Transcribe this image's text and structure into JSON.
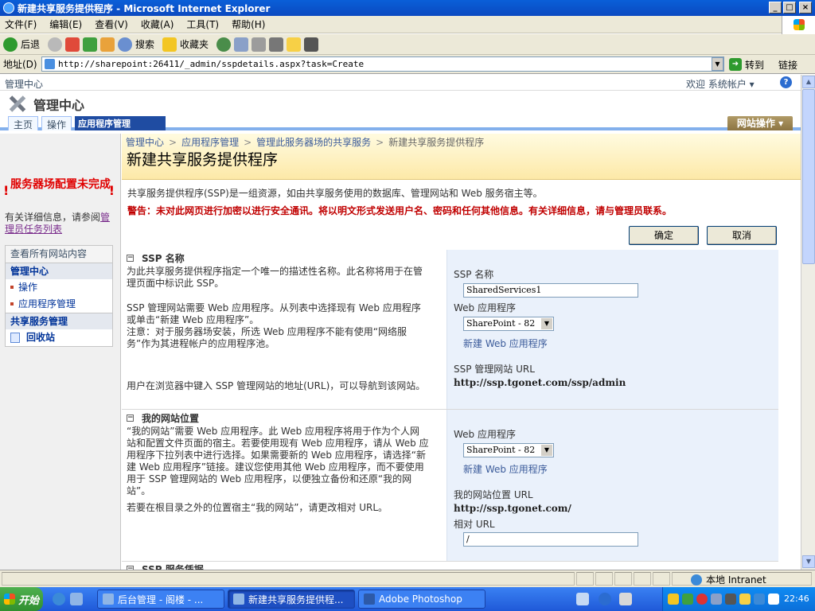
{
  "window": {
    "title": "新建共享服务提供程序 - Microsoft Internet Explorer",
    "min": "_",
    "max": "□",
    "close": "×"
  },
  "menu": [
    "文件(F)",
    "编辑(E)",
    "查看(V)",
    "收藏(A)",
    "工具(T)",
    "帮助(H)"
  ],
  "toolbar": {
    "back": "后退",
    "search": "搜索",
    "favorites": "收藏夹"
  },
  "address": {
    "label": "地址(D)",
    "url": "http://sharepoint:26411/_admin/sspdetails.aspx?task=Create",
    "go": "转到",
    "links": "链接"
  },
  "sp": {
    "top_crumb": "管理中心",
    "welcome": "欢迎 系统帐户 ▾",
    "help": "?",
    "site_title": "管理中心",
    "tabs": [
      "主页",
      "操作",
      "应用程序管理"
    ],
    "site_actions": "网站操作 ▾"
  },
  "leftnav": {
    "warning": "服务器场配置未完成",
    "note_prefix": "有关详细信息，请参阅",
    "note_link": "管理员任务列表",
    "view_all": "查看所有网站内容",
    "head1": "管理中心",
    "items": [
      "操作",
      "应用程序管理"
    ],
    "head2": "共享服务管理",
    "recycle": "回收站"
  },
  "main": {
    "breadcrumb": [
      "管理中心",
      "应用程序管理",
      "管理此服务器场的共享服务",
      "新建共享服务提供程序"
    ],
    "title": "新建共享服务提供程序",
    "desc": "共享服务提供程序(SSP)是一组资源，如由共享服务使用的数据库、管理网站和 Web 服务宿主等。",
    "warning": "警告：未对此网页进行加密以进行安全通讯。将以明文形式发送用户名、密码和任何其他信息。有关详细信息，请与管理员联系。",
    "ok": "确定",
    "cancel": "取消"
  },
  "ssp": {
    "title": "SSP 名称",
    "desc1": "为此共享服务提供程序指定一个唯一的描述性名称。此名称将用于在管理页面中标识此 SSP。",
    "desc2": "SSP 管理网站需要 Web 应用程序。从列表中选择现有 Web 应用程序或单击“新建 Web 应用程序”。",
    "desc3": "注意：对于服务器场安装，所选 Web 应用程序不能有使用“网络服务”作为其进程帐户的应用程序池。",
    "desc4": "用户在浏览器中键入 SSP 管理网站的地址(URL)，可以导航到该网站。",
    "name_label": "SSP 名称",
    "name_value": "SharedServices1",
    "webapp_label": "Web 应用程序",
    "webapp_value": "SharePoint - 82",
    "new_webapp": "新建 Web 应用程序",
    "url_label": "SSP 管理网站 URL",
    "url_value": "http://ssp.tgonet.com/ssp/admin"
  },
  "mysite": {
    "title": "我的网站位置",
    "desc1": "“我的网站”需要 Web 应用程序。此 Web 应用程序将用于作为个人网站和配置文件页面的宿主。若要使用现有 Web 应用程序，请从 Web 应用程序下拉列表中进行选择。如果需要新的 Web 应用程序，请选择“新建 Web 应用程序”链接。建议您使用其他 Web 应用程序，而不要使用用于 SSP 管理网站的 Web 应用程序，以便独立备份和还原“我的网站”。",
    "desc2": "若要在根目录之外的位置宿主“我的网站”，请更改相对 URL。",
    "webapp_label": "Web 应用程序",
    "webapp_value": "SharePoint - 82",
    "new_webapp": "新建 Web 应用程序",
    "url_label": "我的网站位置 URL",
    "url_value": "http://ssp.tgonet.com/",
    "rel_label": "相对 URL",
    "rel_value": "/"
  },
  "next_section": "SSP 服务凭据",
  "status": {
    "zone": "本地 Intranet"
  },
  "taskbar": {
    "start": "开始",
    "tasks": [
      "后台管理 - 阁楼 - ...",
      "新建共享服务提供程...",
      "Adobe Photoshop"
    ],
    "clock": "22:46"
  },
  "colors": {
    "accent": "#1f4ca2",
    "warning": "#c00000",
    "header_bg": "#fde9a8"
  }
}
